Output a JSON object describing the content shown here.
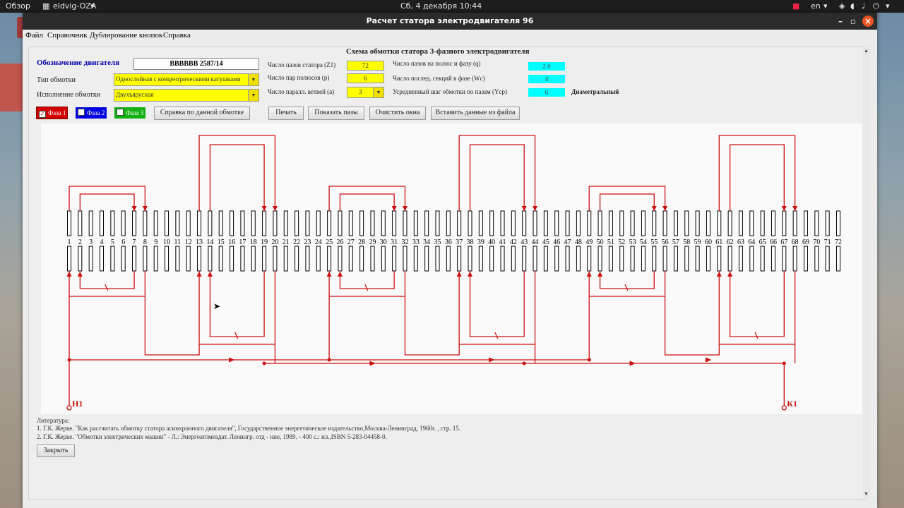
{
  "desktop": {
    "activities": "Обзор",
    "app_menu": "eldvig-OZA",
    "clock": "Сб, 4 декабря  10:44",
    "lang": "en"
  },
  "window": {
    "title": "Расчет статора электродвигателя 96"
  },
  "menu": [
    "Файл",
    "Справочник",
    "Дублирование кнопок",
    "Справка"
  ],
  "form": {
    "designation_label": "Обозначение двигателя",
    "designation_value": "ВВВВВВ 2587/14",
    "schema_title": "Схема обмотки статора 3-фазного электродвигателя",
    "winding_type_label": "Тип обмотки",
    "winding_type_value": "Однослойная с концентрическими катушками",
    "winding_exec_label": "Исполнение обмотки",
    "winding_exec_value": "Двухъярусная",
    "z1_label": "Число пазов статора (Z1)",
    "z1_value": "72",
    "p_label": "Число пар полюсов (p)",
    "p_value": "6",
    "a_label": "Число паралл. ветвей (а)",
    "a_value": "3",
    "q_label": "Число пазов на полюс и фазу (q)",
    "q_value": "2.0",
    "wc_label": "Число послед. секций в фазе (Wc)",
    "wc_value": "4",
    "ycp_label": "Усредненный шаг обмотки по пазам (Yср)",
    "ycp_value": "6",
    "pitch_text": "Диаметральный",
    "phases": [
      {
        "label": "Фаза 1",
        "checked": true,
        "color": "#d40000"
      },
      {
        "label": "Фаза 2",
        "checked": false,
        "color": "#0000e0"
      },
      {
        "label": "Фаза 3",
        "checked": false,
        "color": "#12b012"
      }
    ],
    "btn_help": "Справка по  данной обмотке",
    "btn_print": "Печать",
    "btn_show": "Показать пазы",
    "btn_clear": "Очистить окна",
    "btn_insert": "Вставить данные из файла"
  },
  "diagram": {
    "slot_count": 72,
    "start_label": "Н1",
    "end_label": "К1",
    "phase_color": "#cc1111"
  },
  "literature": {
    "title": "Литература:",
    "items": [
      "1. Г.К. Жерве. \"Как рассчитать обмотку статора асинхронного двигателя\", Государственное энергетическое издательство,Москва-Ленинград, 1960г. , стр. 15.",
      "2. Г.К. Жерве. \"Обмотки электрических машин\" - Л.: Энергоатомиздат. Ленингр. отд - ние, 1989. - 400 с.: ил.,ISBN 5-283-04458-0."
    ]
  },
  "close_label": "Закрыть"
}
